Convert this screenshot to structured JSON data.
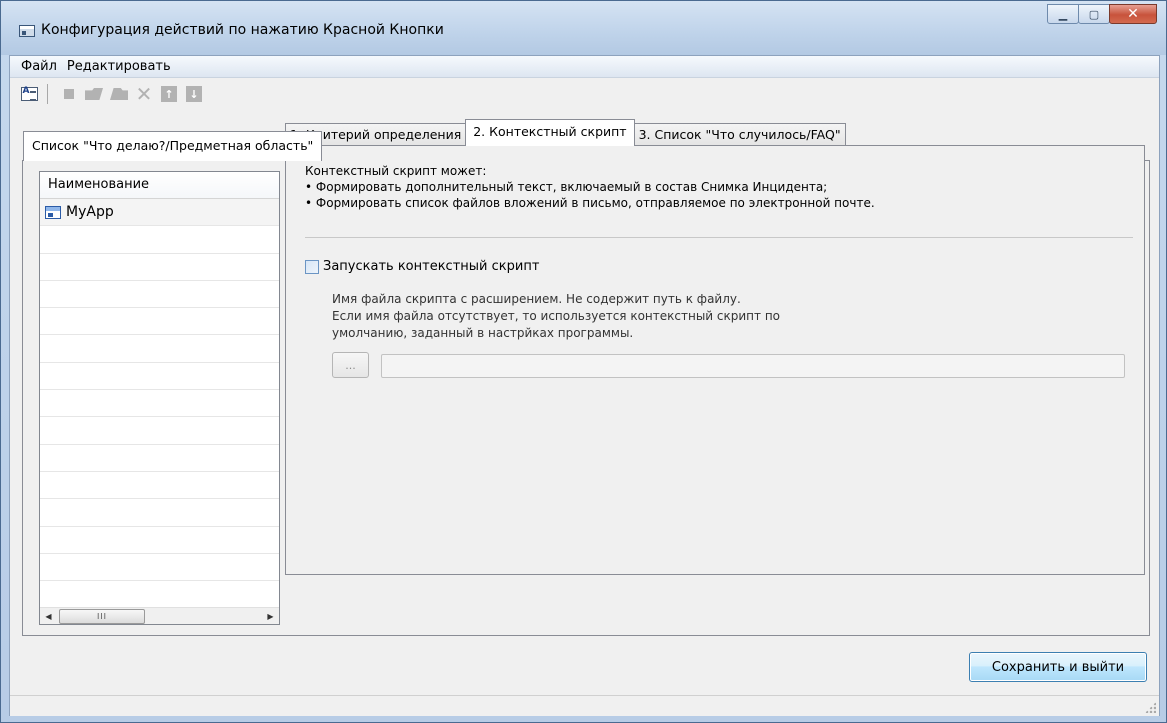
{
  "window": {
    "title": "Конфигурация действий по нажатию Красной Кнопки",
    "controls": {
      "minimize": "▁",
      "maximize": "▢",
      "close": "✕"
    }
  },
  "menu": {
    "items": [
      "Файл",
      "Редактировать"
    ]
  },
  "toolbar": {
    "buttons": [
      {
        "icon": "properties-icon",
        "enabled": true
      },
      {
        "icon": "new-item-icon",
        "enabled": false
      },
      {
        "icon": "open-icon",
        "enabled": false
      },
      {
        "icon": "open-alt-icon",
        "enabled": false
      },
      {
        "icon": "delete-icon",
        "enabled": false
      },
      {
        "icon": "move-up-icon",
        "enabled": false
      },
      {
        "icon": "move-down-icon",
        "enabled": false
      }
    ],
    "glyphs": {
      "delete": "✕",
      "up": "↑",
      "down": "↓"
    }
  },
  "outer_tab": {
    "label": "Список \"Что делаю?/Предметная область\""
  },
  "list": {
    "header": "Наименование",
    "rows": [
      "MyApp",
      "",
      "",
      "",
      "",
      "",
      "",
      "",
      "",
      "",
      "",
      "",
      "",
      "",
      ""
    ],
    "scrollbar": {
      "left": "◀",
      "thumb": "III",
      "right": "▶"
    }
  },
  "inner_tabs": {
    "items": [
      {
        "label": "1. Критерий определения",
        "active": false
      },
      {
        "label": "2. Контекстный скрипт",
        "active": true
      },
      {
        "label": "3. Список \"Что случилось/FAQ\"",
        "active": false
      }
    ]
  },
  "context_script": {
    "intro": "Контекстный скрипт  может:",
    "bullets": [
      "• Формировать дополнительный текст, включаемый в состав Снимка Инцидента;",
      "• Формировать список файлов вложений в письмо, отправляемое по электронной почте."
    ],
    "checkbox_label": "Запускать контекстный скрипт",
    "checkbox_checked": false,
    "hint_lines": [
      "Имя файла скрипта с расширением. Не содержит путь к файлу.",
      "Если имя файла отсутствует, то используется контекстный скрипт по",
      "умолчанию, заданный в настрйках программы."
    ],
    "browse_label": "...",
    "path_value": ""
  },
  "footer": {
    "save_label": "Сохранить и выйти"
  },
  "colors": {
    "accent": "#3c7fb1",
    "title_bar": "#bfd3ea",
    "close": "#c8533c"
  }
}
